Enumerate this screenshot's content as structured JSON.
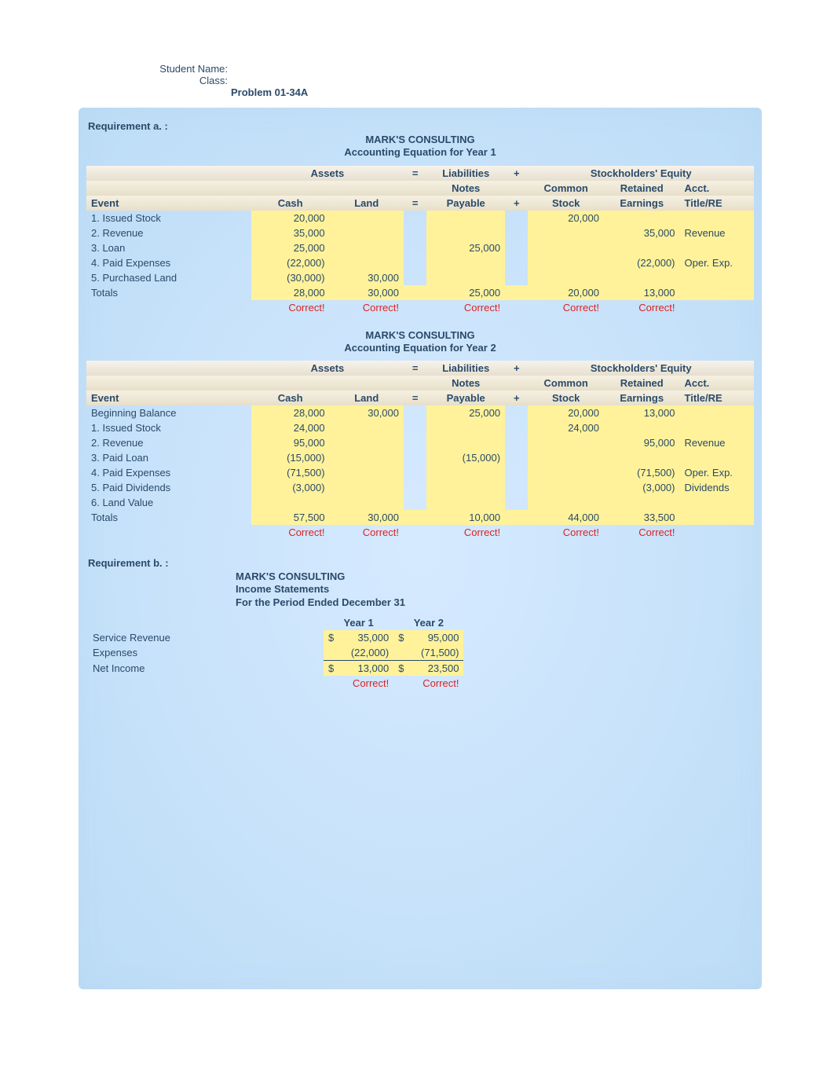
{
  "header": {
    "studentName": "Student Name:",
    "className": "Class:",
    "problem": "Problem 01-34A"
  },
  "requirements": {
    "a": "Requirement a. :",
    "b": "Requirement b. :"
  },
  "company": "MARK'S CONSULTING",
  "reportTitles": {
    "year1": "Accounting Equation for Year 1",
    "year2": "Accounting Equation for Year 2",
    "income1": "Income Statements",
    "income2": "For the Period Ended December 31"
  },
  "columns": {
    "assets": "Assets",
    "eq": "=",
    "liabilities": "Liabilities",
    "plus": "+",
    "se": "Stockholders' Equity",
    "event": "Event",
    "cash": "Cash",
    "land": "Land",
    "np1": "Notes",
    "np2": "Payable",
    "cs1": "Common",
    "cs2": "Stock",
    "re1": "Retained",
    "re2": "Earnings",
    "acct1": "Acct.",
    "acct2": "Title/RE"
  },
  "year1Rows": [
    {
      "event": "1. Issued Stock",
      "cash": "20,000",
      "land": "",
      "np": "",
      "cs": "20,000",
      "re": "",
      "acct": ""
    },
    {
      "event": "2. Revenue",
      "cash": "35,000",
      "land": "",
      "np": "",
      "cs": "",
      "re": "35,000",
      "acct": "Revenue"
    },
    {
      "event": "3. Loan",
      "cash": "25,000",
      "land": "",
      "np": "25,000",
      "cs": "",
      "re": "",
      "acct": ""
    },
    {
      "event": "4. Paid Expenses",
      "cash": "(22,000)",
      "land": "",
      "np": "",
      "cs": "",
      "re": "(22,000)",
      "acct": "Oper. Exp."
    },
    {
      "event": "5. Purchased Land",
      "cash": "(30,000)",
      "land": "30,000",
      "np": "",
      "cs": "",
      "re": "",
      "acct": ""
    }
  ],
  "year1Totals": {
    "event": "Totals",
    "cash": "28,000",
    "land": "30,000",
    "np": "25,000",
    "cs": "20,000",
    "re": "13,000"
  },
  "year2Rows": [
    {
      "event": "Beginning Balance",
      "cash": "28,000",
      "land": "30,000",
      "np": "25,000",
      "cs": "20,000",
      "re": "13,000",
      "acct": ""
    },
    {
      "event": "1. Issued Stock",
      "cash": "24,000",
      "land": "",
      "np": "",
      "cs": "24,000",
      "re": "",
      "acct": ""
    },
    {
      "event": "2. Revenue",
      "cash": "95,000",
      "land": "",
      "np": "",
      "cs": "",
      "re": "95,000",
      "acct": "Revenue"
    },
    {
      "event": "3. Paid Loan",
      "cash": "(15,000)",
      "land": "",
      "np": "(15,000)",
      "cs": "",
      "re": "",
      "acct": ""
    },
    {
      "event": "4. Paid Expenses",
      "cash": "(71,500)",
      "land": "",
      "np": "",
      "cs": "",
      "re": "(71,500)",
      "acct": "Oper. Exp."
    },
    {
      "event": "5. Paid Dividends",
      "cash": "(3,000)",
      "land": "",
      "np": "",
      "cs": "",
      "re": "(3,000)",
      "acct": "Dividends"
    },
    {
      "event": "6. Land Value",
      "cash": "",
      "land": "",
      "np": "",
      "cs": "",
      "re": "",
      "acct": ""
    }
  ],
  "year2Totals": {
    "event": "Totals",
    "cash": "57,500",
    "land": "30,000",
    "np": "10,000",
    "cs": "44,000",
    "re": "33,500"
  },
  "correct": "Correct!",
  "income": {
    "year1": "Year 1",
    "year2": "Year 2",
    "serviceRevenue": "Service Revenue",
    "expenses": "Expenses",
    "netIncome": "Net Income",
    "y1sr": "35,000",
    "y2sr": "95,000",
    "y1ex": "(22,000)",
    "y2ex": "(71,500)",
    "y1ni": "13,000",
    "y2ni": "23,500",
    "dollar": "$"
  }
}
